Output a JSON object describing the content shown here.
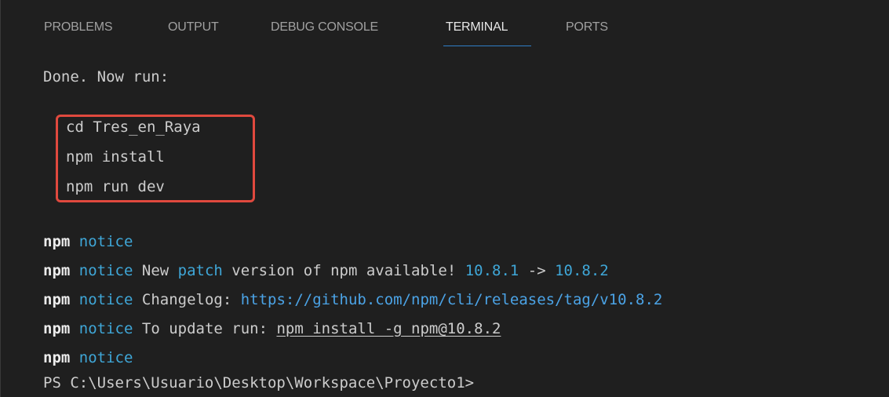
{
  "tabs": [
    {
      "label": "PROBLEMS",
      "active": false
    },
    {
      "label": "OUTPUT",
      "active": false
    },
    {
      "label": "DEBUG CONSOLE",
      "active": false
    },
    {
      "label": "TERMINAL",
      "active": true
    },
    {
      "label": "PORTS",
      "active": false
    }
  ],
  "terminal": {
    "done_line": "Done. Now run:",
    "commands": [
      "cd Tres_en_Raya",
      "npm install",
      "npm run dev"
    ],
    "npm_prefix": "npm",
    "notice_word": "notice",
    "update_line": {
      "text_a": "New ",
      "patch": "patch",
      "text_b": " version of npm available! ",
      "old_version": "10.8.1",
      "arrow": " -> ",
      "new_version": "10.8.2"
    },
    "changelog_line": {
      "label": "Changelog: ",
      "url": "https://github.com/npm/cli/releases/tag/v10.8.2"
    },
    "update_run_line": {
      "label": "To update run: ",
      "command": "npm install -g npm@10.8.2"
    },
    "prompt": "PS C:\\Users\\Usuario\\Desktop\\Workspace\\Proyecto1>"
  },
  "colors": {
    "background": "#1f1f1f",
    "active_tab_underline": "#2f7ec8",
    "highlight_border": "#e0493e",
    "notice_blue": "#3fa7d8"
  }
}
